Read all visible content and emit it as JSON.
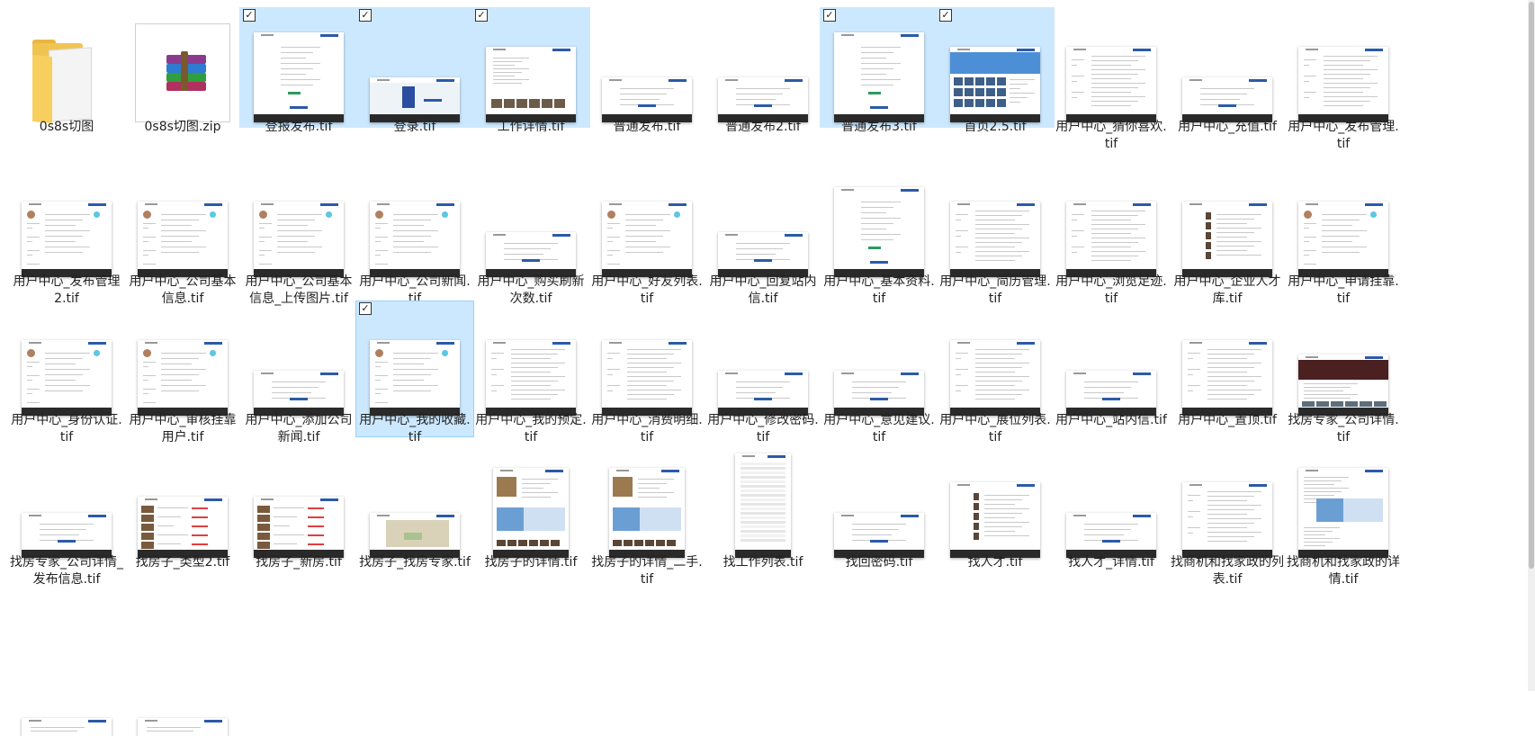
{
  "items": [
    {
      "label": "0s8s切图",
      "kind": "folder",
      "selected": false,
      "checked": false
    },
    {
      "label": "0s8s切图.zip",
      "kind": "zip",
      "selected": false,
      "checked": false
    },
    {
      "label": "登报发布.tif",
      "kind": "page",
      "variant": "form",
      "selected": true,
      "checked": true
    },
    {
      "label": "登录.tif",
      "kind": "page",
      "variant": "login",
      "selected": true,
      "checked": true
    },
    {
      "label": "工作详情.tif",
      "kind": "page",
      "variant": "photos",
      "selected": true,
      "checked": true
    },
    {
      "label": "普通发布.tif",
      "kind": "page",
      "variant": "short",
      "selected": false,
      "checked": false
    },
    {
      "label": "普通发布2.tif",
      "kind": "page",
      "variant": "short",
      "selected": false,
      "checked": false
    },
    {
      "label": "普通发布3.tif",
      "kind": "page",
      "variant": "form",
      "selected": true,
      "checked": true
    },
    {
      "label": "首页2.5.tif",
      "kind": "page",
      "variant": "home",
      "selected": true,
      "checked": true
    },
    {
      "label": "用户中心_猜你喜欢.tif",
      "kind": "page",
      "variant": "list",
      "selected": false,
      "checked": false
    },
    {
      "label": "用户中心_充值.tif",
      "kind": "page",
      "variant": "short",
      "selected": false,
      "checked": false
    },
    {
      "label": "用户中心_发布管理.tif",
      "kind": "page",
      "variant": "list",
      "selected": false,
      "checked": false
    },
    {
      "label": "用户中心_发布管理2.tif",
      "kind": "page",
      "variant": "user",
      "selected": false,
      "checked": false
    },
    {
      "label": "用户中心_公司基本信息.tif",
      "kind": "page",
      "variant": "user",
      "selected": false,
      "checked": false
    },
    {
      "label": "用户中心_公司基本信息_上传图片.tif",
      "kind": "page",
      "variant": "user",
      "selected": false,
      "checked": false
    },
    {
      "label": "用户中心_公司新闻.tif",
      "kind": "page",
      "variant": "user",
      "selected": false,
      "checked": false
    },
    {
      "label": "用户中心_购买刷新次数.tif",
      "kind": "page",
      "variant": "short",
      "selected": false,
      "checked": false
    },
    {
      "label": "用户中心_好友列表.tif",
      "kind": "page",
      "variant": "user",
      "selected": false,
      "checked": false
    },
    {
      "label": "用户中心_回复站内信.tif",
      "kind": "page",
      "variant": "short",
      "selected": false,
      "checked": false
    },
    {
      "label": "用户中心_基本资料.tif",
      "kind": "page",
      "variant": "form",
      "selected": false,
      "checked": false
    },
    {
      "label": "用户中心_简历管理.tif",
      "kind": "page",
      "variant": "list",
      "selected": false,
      "checked": false
    },
    {
      "label": "用户中心_浏览足迹.tif",
      "kind": "page",
      "variant": "list",
      "selected": false,
      "checked": false
    },
    {
      "label": "用户中心_企业人才库.tif",
      "kind": "page",
      "variant": "people",
      "selected": false,
      "checked": false
    },
    {
      "label": "用户中心_申请挂靠.tif",
      "kind": "page",
      "variant": "user",
      "selected": false,
      "checked": false
    },
    {
      "label": "用户中心_身份认证.tif",
      "kind": "page",
      "variant": "user",
      "selected": false,
      "checked": false
    },
    {
      "label": "用户中心_审核挂靠用户.tif",
      "kind": "page",
      "variant": "user",
      "selected": false,
      "checked": false
    },
    {
      "label": "用户中心_添加公司新闻.tif",
      "kind": "page",
      "variant": "short",
      "selected": false,
      "checked": false
    },
    {
      "label": "用户中心_我的收藏.tif",
      "kind": "page",
      "variant": "user",
      "selected": true,
      "checked": true,
      "bordered": true
    },
    {
      "label": "用户中心_我的预定.tif",
      "kind": "page",
      "variant": "list",
      "selected": false,
      "checked": false
    },
    {
      "label": "用户中心_消费明细.tif",
      "kind": "page",
      "variant": "list",
      "selected": false,
      "checked": false
    },
    {
      "label": "用户中心_修改密码.tif",
      "kind": "page",
      "variant": "short",
      "selected": false,
      "checked": false
    },
    {
      "label": "用户中心_意见建议.tif",
      "kind": "page",
      "variant": "short",
      "selected": false,
      "checked": false
    },
    {
      "label": "用户中心_展位列表.tif",
      "kind": "page",
      "variant": "list",
      "selected": false,
      "checked": false
    },
    {
      "label": "用户中心_站内信.tif",
      "kind": "page",
      "variant": "short",
      "selected": false,
      "checked": false
    },
    {
      "label": "用户中心_置顶.tif",
      "kind": "page",
      "variant": "list",
      "selected": false,
      "checked": false
    },
    {
      "label": "找房专家_公司详情.tif",
      "kind": "page",
      "variant": "banner",
      "selected": false,
      "checked": false
    },
    {
      "label": "找房专家_公司详情_发布信息.tif",
      "kind": "page",
      "variant": "short",
      "selected": false,
      "checked": false
    },
    {
      "label": "找房子_类型2.tif",
      "kind": "page",
      "variant": "house",
      "selected": false,
      "checked": false
    },
    {
      "label": "找房子_新房.tif",
      "kind": "page",
      "variant": "house",
      "selected": false,
      "checked": false
    },
    {
      "label": "找房子_找房专家.tif",
      "kind": "page",
      "variant": "map",
      "selected": false,
      "checked": false
    },
    {
      "label": "找房子的详情.tif",
      "kind": "page",
      "variant": "detail",
      "selected": false,
      "checked": false
    },
    {
      "label": "找房子的详情_二手.tif",
      "kind": "page",
      "variant": "detail",
      "selected": false,
      "checked": false
    },
    {
      "label": "找工作列表.tif",
      "kind": "page",
      "variant": "tall",
      "selected": false,
      "checked": false
    },
    {
      "label": "找回密码.tif",
      "kind": "page",
      "variant": "short",
      "selected": false,
      "checked": false
    },
    {
      "label": "找人才.tif",
      "kind": "page",
      "variant": "people",
      "selected": false,
      "checked": false
    },
    {
      "label": "找人才_详情.tif",
      "kind": "page",
      "variant": "short",
      "selected": false,
      "checked": false
    },
    {
      "label": "找商机和找家政的列表.tif",
      "kind": "page",
      "variant": "list",
      "selected": false,
      "checked": false
    },
    {
      "label": "找商机和找家政的详情.tif",
      "kind": "page",
      "variant": "detail2",
      "selected": false,
      "checked": false
    },
    {
      "label": "",
      "kind": "page",
      "variant": "partial",
      "selected": false,
      "checked": false
    },
    {
      "label": "",
      "kind": "page",
      "variant": "partial",
      "selected": false,
      "checked": false
    }
  ],
  "check_mark": "✓",
  "colors": {
    "selection": "#cce8ff",
    "selection_border": "#99d1ff",
    "footer": "#2a2a2a",
    "accent": "#2b5aa8"
  }
}
